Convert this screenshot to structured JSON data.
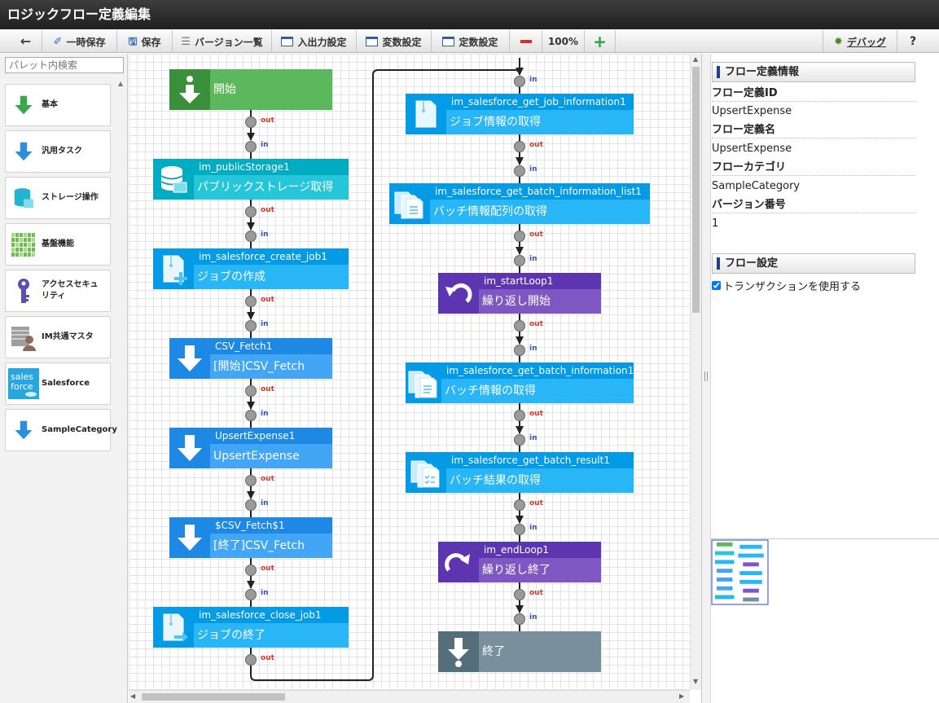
{
  "window": {
    "title": "ロジックフロー定義編集"
  },
  "toolbar": {
    "back": "",
    "temp_save": "一時保存",
    "save": "保存",
    "versions": "バージョン一覧",
    "io_settings": "入出力設定",
    "var_settings": "変数設定",
    "const_settings": "定数設定",
    "zoom": "100%",
    "debug": "デバッグ",
    "help": "?"
  },
  "palette": {
    "search_placeholder": "パレット内検索",
    "items": [
      {
        "label": "基本",
        "icon": "arrow-down-icon",
        "color": "#3aa84a"
      },
      {
        "label": "汎用タスク",
        "icon": "arrow-down-icon",
        "color": "#2d8ee0"
      },
      {
        "label": "ストレージ操作",
        "icon": "database-icon",
        "color": "#26b3d0"
      },
      {
        "label": "基盤機能",
        "icon": "grid-icon",
        "color": "#6cbf4a"
      },
      {
        "label": "アクセスセキュリティ",
        "icon": "key-icon",
        "color": "#5a50b0"
      },
      {
        "label": "IM共通マスタ",
        "icon": "master-icon",
        "color": "#8a6b5a"
      },
      {
        "label": "Salesforce",
        "icon": "salesforce-icon",
        "color": "#29a6e0"
      },
      {
        "label": "SampleCategory",
        "icon": "arrow-down-icon",
        "color": "#2d8ee0"
      }
    ]
  },
  "flow": {
    "port_out": "out",
    "port_in": "in",
    "nodes": [
      {
        "id": "n1",
        "name": "",
        "label": "開始",
        "icon": "start-icon"
      },
      {
        "id": "n2",
        "name": "im_publicStorage1",
        "label": "パブリックストレージ取得",
        "icon": "database-icon"
      },
      {
        "id": "n3",
        "name": "im_salesforce_create_job1",
        "label": "ジョブの作成",
        "icon": "job-create-icon"
      },
      {
        "id": "n4",
        "name": "CSV_Fetch1",
        "label": "[開始]CSV_Fetch",
        "icon": "arrow-down-icon"
      },
      {
        "id": "n5",
        "name": "UpsertExpense1",
        "label": "UpsertExpense",
        "icon": "arrow-down-icon"
      },
      {
        "id": "n6",
        "name": "$CSV_Fetch$1",
        "label": "[終了]CSV_Fetch",
        "icon": "arrow-down-icon"
      },
      {
        "id": "n7",
        "name": "im_salesforce_close_job1",
        "label": "ジョブの終了",
        "icon": "job-close-icon"
      },
      {
        "id": "n8",
        "name": "im_salesforce_get_job_information1",
        "label": "ジョブ情報の取得",
        "icon": "job-info-icon"
      },
      {
        "id": "n9",
        "name": "im_salesforce_get_batch_information_list1",
        "label": "バッチ情報配列の取得",
        "icon": "batch-list-icon"
      },
      {
        "id": "n10",
        "name": "im_startLoop1",
        "label": "繰り返し開始",
        "icon": "loop-start-icon"
      },
      {
        "id": "n11",
        "name": "im_salesforce_get_batch_information1",
        "label": "バッチ情報の取得",
        "icon": "batch-info-icon"
      },
      {
        "id": "n12",
        "name": "im_salesforce_get_batch_result1",
        "label": "バッチ結果の取得",
        "icon": "batch-result-icon"
      },
      {
        "id": "n13",
        "name": "im_endLoop1",
        "label": "繰り返し終了",
        "icon": "loop-end-icon"
      },
      {
        "id": "n14",
        "name": "",
        "label": "終了",
        "icon": "end-icon"
      }
    ]
  },
  "properties": {
    "flow_info_header": "フロー定義情報",
    "flow_id_label": "フロー定義ID",
    "flow_id_value": "UpsertExpense",
    "flow_name_label": "フロー定義名",
    "flow_name_value": "UpsertExpense",
    "category_label": "フローカテゴリ",
    "category_value": "SampleCategory",
    "version_label": "バージョン番号",
    "version_value": "1",
    "flow_settings_header": "フロー設定",
    "use_transaction_label": "トランザクションを使用する",
    "use_transaction_checked": true
  },
  "colors": {
    "start": "#5cb85c",
    "start_dark": "#3a8f3a",
    "storage": "#26c6da",
    "storage_dark": "#00acc1",
    "salesforce": "#29b6f6",
    "salesforce_dark": "#039be5",
    "task": "#42a5f5",
    "task_dark": "#1e88e5",
    "loop": "#7e57c2",
    "loop_dark": "#5e35b1",
    "end": "#78909c",
    "end_dark": "#546e7a"
  }
}
